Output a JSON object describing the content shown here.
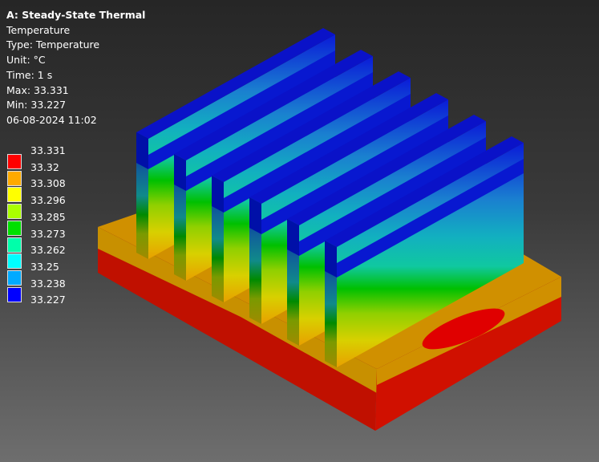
{
  "header": {
    "title": "A: Steady-State Thermal",
    "result": "Temperature",
    "type": "Type: Temperature",
    "unit": "Unit: °C",
    "time": "Time: 1 s",
    "max": "Max: 33.331",
    "min": "Min: 33.227",
    "timestamp": "06-08-2024 11:02"
  },
  "legend": {
    "values": [
      "33.331",
      "33.32",
      "33.308",
      "33.296",
      "33.285",
      "33.273",
      "33.262",
      "33.25",
      "33.238",
      "33.227"
    ],
    "colors": [
      "#ff0000",
      "#ffaa00",
      "#ffff00",
      "#aaff00",
      "#00e000",
      "#00ffaa",
      "#00ffff",
      "#00aaff",
      "#0000ff"
    ]
  }
}
